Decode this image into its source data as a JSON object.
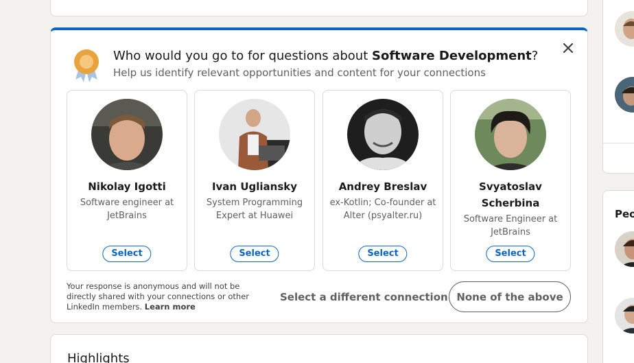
{
  "survey": {
    "question_prefix": "Who would you go to for questions about ",
    "question_topic": "Software Development",
    "question_suffix": "?",
    "subtitle": "Help us identify relevant opportunities and content for your connections",
    "people": [
      {
        "name": "Nikolay Igotti",
        "title": "Software engineer at JetBrains",
        "select_label": "Select"
      },
      {
        "name": "Ivan Ugliansky",
        "title": "System Programming Expert at Huawei",
        "select_label": "Select"
      },
      {
        "name": "Andrey Breslav",
        "title": "ex-Kotlin; Co-founder at Alter (psyalter.ru)",
        "select_label": "Select"
      },
      {
        "name": "Svyatoslav Scherbina",
        "title": "Software Engineer at JetBrains",
        "select_label": "Select"
      }
    ],
    "disclaimer": "Your response is anonymous and will not be directly shared with your connections or other LinkedIn members.",
    "learn_more": "Learn more",
    "different_connection_label": "Select a different connection",
    "none_label": "None of the above"
  },
  "highlights": {
    "title": "Highlights"
  },
  "right_rail": {
    "section_label": "Peo"
  },
  "colors": {
    "accent": "#0a66c2",
    "background": "#f4f2ee"
  }
}
